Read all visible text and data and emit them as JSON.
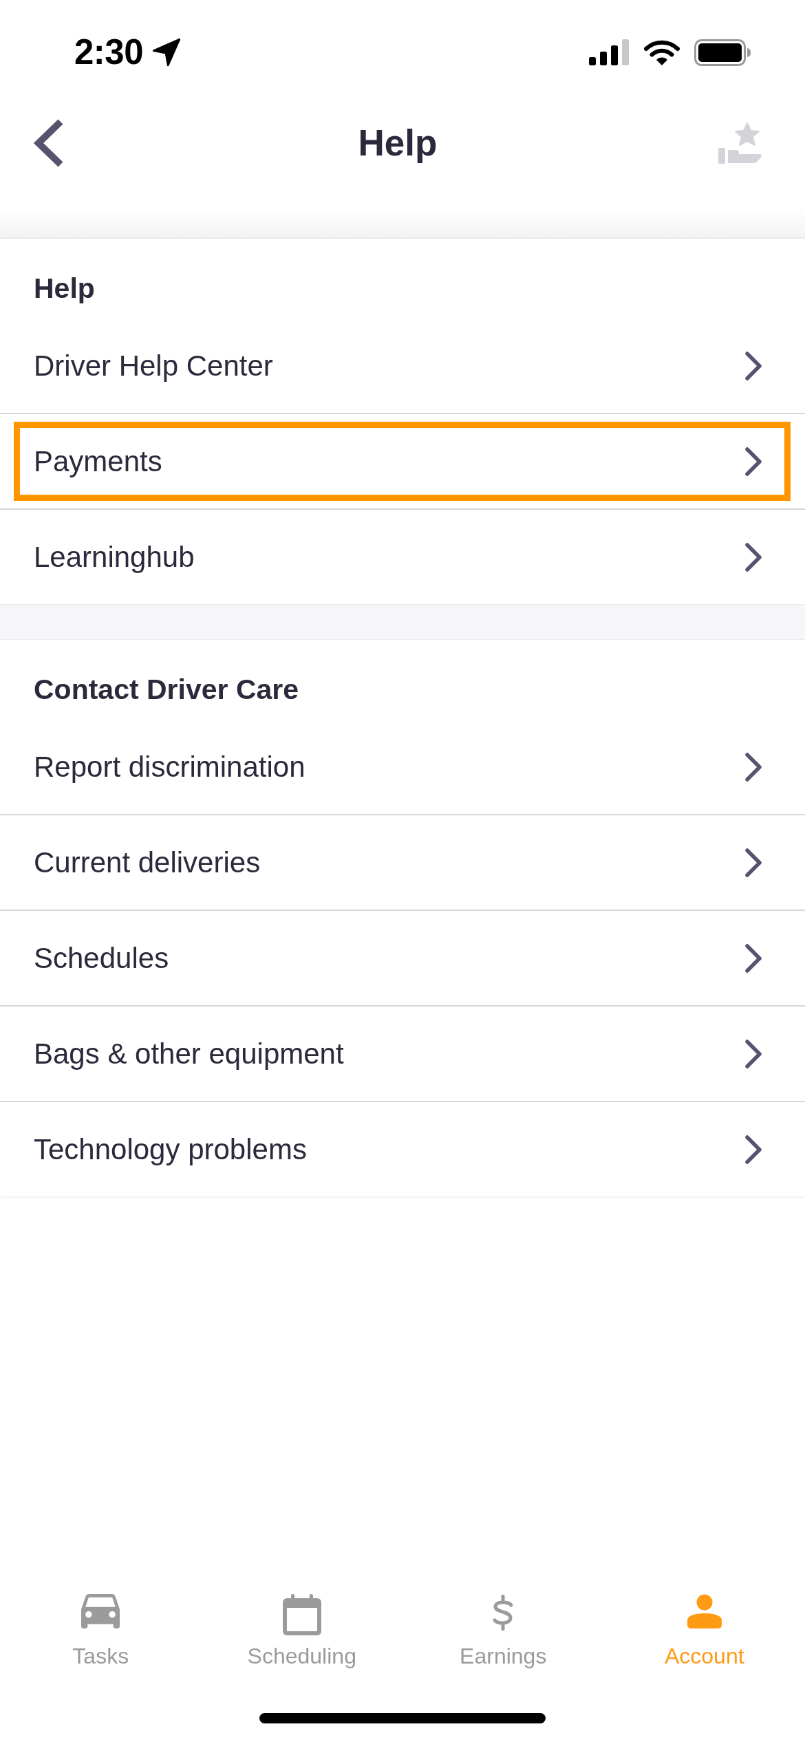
{
  "status_bar": {
    "time": "2:30"
  },
  "header": {
    "title": "Help"
  },
  "sections": [
    {
      "title": "Help",
      "items": [
        {
          "label": "Driver Help Center",
          "highlighted": false
        },
        {
          "label": "Payments",
          "highlighted": true
        },
        {
          "label": "Learninghub",
          "highlighted": false
        }
      ]
    },
    {
      "title": "Contact Driver Care",
      "items": [
        {
          "label": "Report discrimination",
          "highlighted": false
        },
        {
          "label": "Current deliveries",
          "highlighted": false
        },
        {
          "label": "Schedules",
          "highlighted": false
        },
        {
          "label": "Bags & other equipment",
          "highlighted": false
        },
        {
          "label": "Technology problems",
          "highlighted": false
        }
      ]
    }
  ],
  "tab_bar": [
    {
      "label": "Tasks",
      "kind": "car",
      "selected": false
    },
    {
      "label": "Scheduling",
      "kind": "calendar",
      "selected": false
    },
    {
      "label": "Earnings",
      "kind": "dollar",
      "selected": false
    },
    {
      "label": "Account",
      "kind": "person",
      "selected": true
    }
  ]
}
